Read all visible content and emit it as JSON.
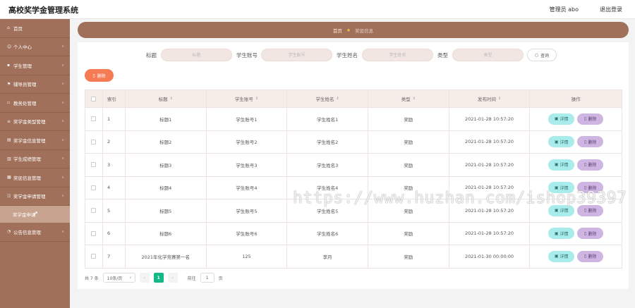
{
  "app": {
    "title": "高校奖学金管理系统"
  },
  "header": {
    "user": "管理员 abo",
    "logout": "退出登录"
  },
  "sidebar": {
    "items": [
      {
        "label": "首页",
        "icon": "home-icon",
        "expandable": false
      },
      {
        "label": "个人中心",
        "icon": "user-icon",
        "expandable": true
      },
      {
        "label": "学生管理",
        "icon": "student-icon",
        "expandable": true
      },
      {
        "label": "辅导员管理",
        "icon": "counselor-icon",
        "expandable": true
      },
      {
        "label": "教务处管理",
        "icon": "office-icon",
        "expandable": true
      },
      {
        "label": "奖学金类型管理",
        "icon": "list-icon",
        "expandable": true
      },
      {
        "label": "奖学金信息管理",
        "icon": "info-icon",
        "expandable": true
      },
      {
        "label": "学生成绩管理",
        "icon": "grade-icon",
        "expandable": true
      },
      {
        "label": "奖惩信息管理",
        "icon": "award-icon",
        "expandable": true
      },
      {
        "label": "奖学金申请管理",
        "icon": "apply-icon",
        "expandable": true
      }
    ],
    "subitem": "奖学金申请",
    "last_item": {
      "label": "公告信息管理",
      "icon": "notice-icon"
    }
  },
  "breadcrumb": {
    "home": "首页",
    "separator": "★",
    "current": "奖惩信息"
  },
  "search": {
    "fields": [
      {
        "label": "标题",
        "placeholder": "标题"
      },
      {
        "label": "学生账号",
        "placeholder": "学生账号"
      },
      {
        "label": "学生姓名",
        "placeholder": "学生姓名"
      },
      {
        "label": "类型",
        "placeholder": "类型"
      }
    ],
    "button": "查询"
  },
  "toolbar": {
    "delete": "删除"
  },
  "table": {
    "columns": [
      "索引",
      "标题",
      "学生账号",
      "学生姓名",
      "类型",
      "发布时间",
      "操作"
    ],
    "sort_icon": "⇕",
    "rows": [
      {
        "index": "1",
        "title": "标题1",
        "account": "学生账号1",
        "name": "学生姓名1",
        "type": "奖励",
        "time": "2021-01-28 10:57:20"
      },
      {
        "index": "2",
        "title": "标题2",
        "account": "学生账号2",
        "name": "学生姓名2",
        "type": "奖励",
        "time": "2021-01-28 10:57:20"
      },
      {
        "index": "3",
        "title": "标题3",
        "account": "学生账号3",
        "name": "学生姓名3",
        "type": "奖励",
        "time": "2021-01-28 10:57:20"
      },
      {
        "index": "4",
        "title": "标题4",
        "account": "学生账号4",
        "name": "学生姓名4",
        "type": "奖励",
        "time": "2021-01-28 10:57:20"
      },
      {
        "index": "5",
        "title": "标题5",
        "account": "学生账号5",
        "name": "学生姓名5",
        "type": "奖励",
        "time": "2021-01-28 10:57:20"
      },
      {
        "index": "6",
        "title": "标题6",
        "account": "学生账号6",
        "name": "学生姓名6",
        "type": "奖励",
        "time": "2021-01-28 10:57:20"
      },
      {
        "index": "7",
        "title": "2021年化学竞赛第一名",
        "account": "125",
        "name": "李月",
        "type": "奖励",
        "time": "2021-01-30 00:00:00"
      }
    ],
    "detail_label": "详情",
    "delete_label": "删除"
  },
  "pagination": {
    "total": "共 7 条",
    "page_size": "10条/页",
    "current_page": "1",
    "goto_label": "前往",
    "goto_value": "1",
    "page_unit": "页"
  },
  "watermark": "https://www.huzhan.com/ishop39397",
  "colors": {
    "sidebar": "#a0705a",
    "accent_delete": "#f47b54",
    "detail_button": "#a8eceb",
    "row_delete_button": "#cfb5e2",
    "pager_active": "#12b886"
  }
}
